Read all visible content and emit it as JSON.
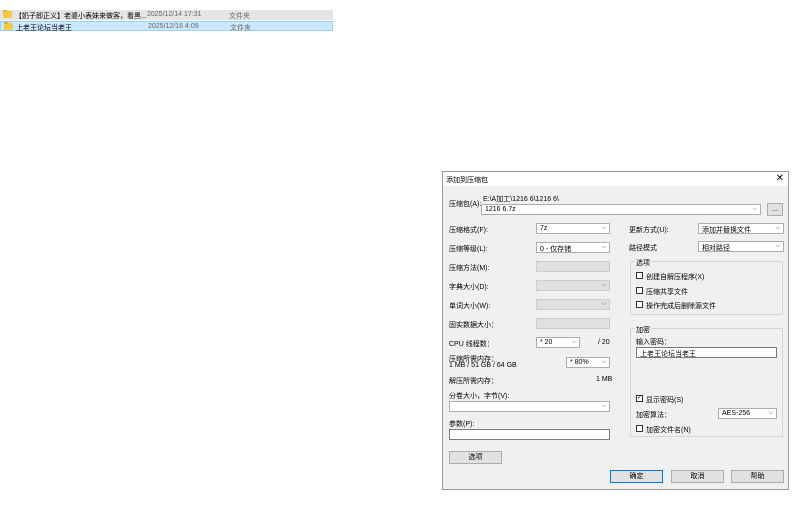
{
  "explorer": {
    "rows": [
      {
        "name": "【奶子即正义】老婆小表妹来做客，看黑...",
        "date": "2025/12/14 17:31",
        "type": "文件夹"
      },
      {
        "name": "上老王论坛当老王",
        "date": "2025/12/16 4:09",
        "type": "文件夹"
      }
    ]
  },
  "dialog": {
    "title": "添加到压缩包",
    "archive_label": "压缩包(A):",
    "archive_path": "E:\\A加工\\1216 6\\1216 6\\",
    "archive_name": "1216 6.7z",
    "browse_label": "...",
    "format_label": "压缩格式(F):",
    "format_value": "7z",
    "level_label": "压缩等级(L):",
    "level_value": "0 - 仅存储",
    "method_label": "压缩方法(M):",
    "dict_label": "字典大小(D):",
    "word_label": "单词大小(W):",
    "solid_label": "固实数据大小：",
    "cpu_label": "CPU 线程数：",
    "cpu_value": "* 20",
    "cpu_max": "/ 20",
    "mem_label": "压缩所需内存：",
    "mem_sub": "1 MB / 51 GB / 64 GB",
    "mem_value": "* 80%",
    "decomp_label": "解压所需内存：",
    "decomp_value": "1 MB",
    "split_label": "分卷大小，字节(V):",
    "param_label": "参数(P):",
    "options_button": "选项",
    "update_label": "更新方式(U):",
    "update_value": "添加并替换文件",
    "path_label": "路径模式",
    "path_value": "相对路径",
    "options_group": "选项",
    "opt_sfx": "创建自解压程序(X)",
    "opt_shared": "压缩共享文件",
    "opt_delete": "操作完成后删除源文件",
    "enc_group": "加密",
    "pwd_label": "输入密码：",
    "pwd_value": "上老王论坛当老王",
    "show_pwd": "显示密码(S)",
    "check_mark": "✓",
    "enc_method_label": "加密算法：",
    "enc_method_value": "AES-256",
    "enc_names": "加密文件名(N)",
    "ok": "确定",
    "cancel": "取消",
    "help": "帮助",
    "close": "✕",
    "arrow": "⌵"
  }
}
